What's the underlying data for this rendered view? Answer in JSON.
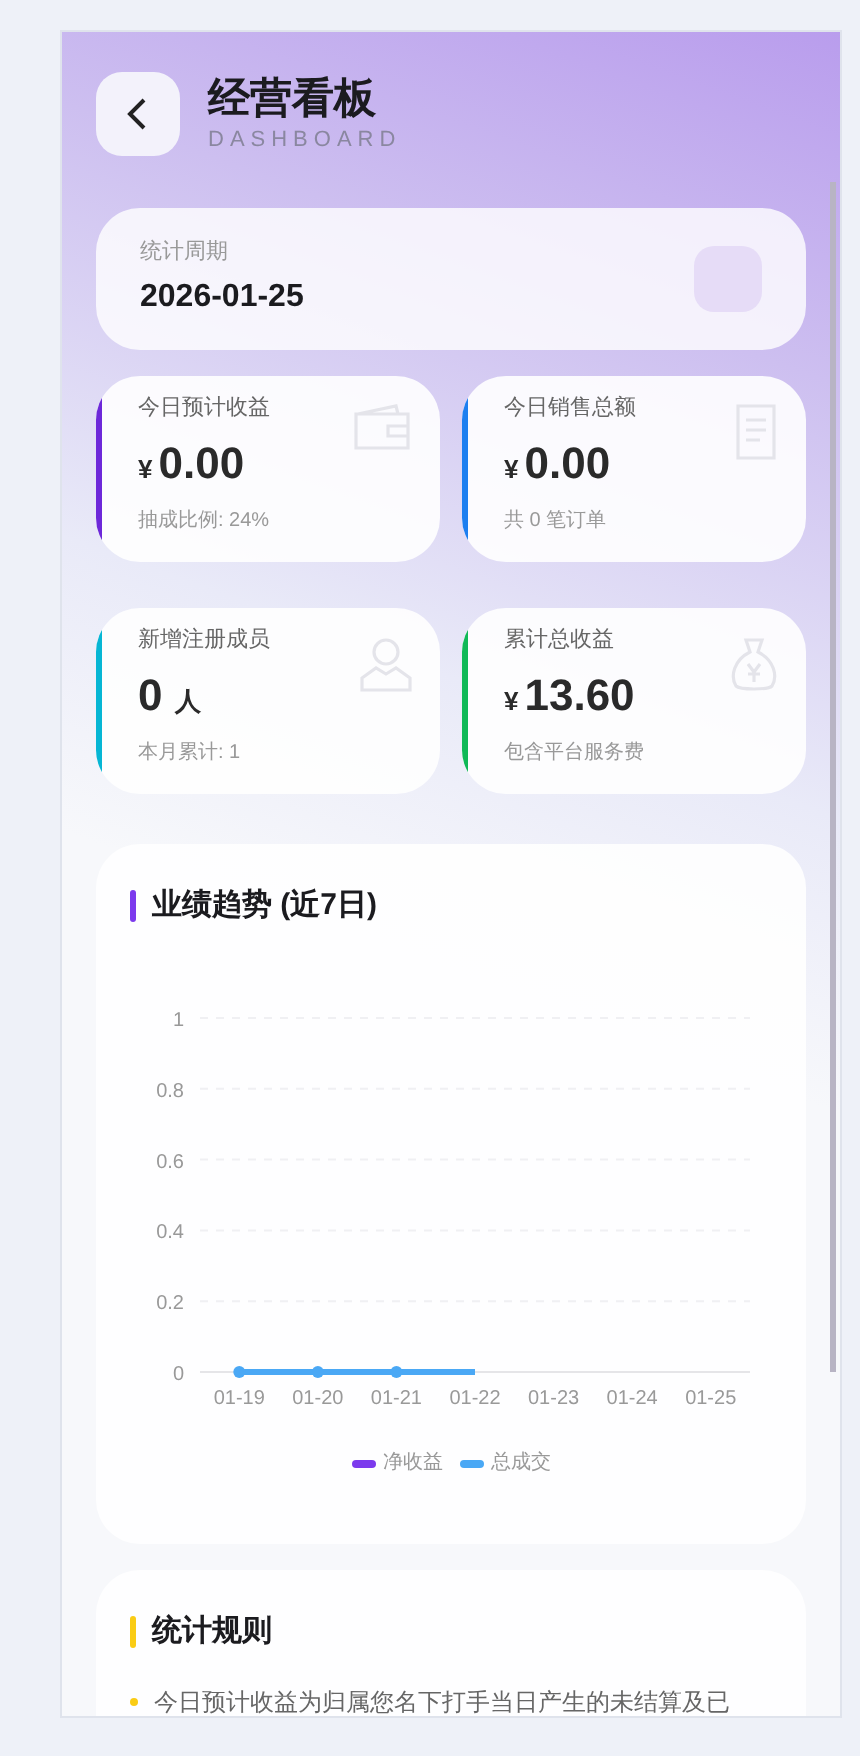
{
  "header": {
    "title": "经营看板",
    "subtitle": "DASHBOARD"
  },
  "period": {
    "label": "统计周期",
    "value": "2026-01-25"
  },
  "stats": [
    {
      "label": "今日预计收益",
      "currency": "¥",
      "value": "0.00",
      "note": "抽成比例: 24%",
      "color": "#6d28d9",
      "kind": "wallet"
    },
    {
      "label": "今日销售总额",
      "currency": "¥",
      "value": "0.00",
      "note": "共 0 笔订单",
      "color": "#1d7ff0",
      "kind": "document"
    },
    {
      "label": "新增注册成员",
      "value": "0",
      "unit": "人",
      "note": "本月累计: 1",
      "color": "#06b6d4",
      "kind": "person"
    },
    {
      "label": "累计总收益",
      "currency": "¥",
      "value": "13.60",
      "note": "包含平台服务费",
      "color": "#10b957",
      "kind": "moneybag"
    }
  ],
  "trend": {
    "title": "业绩趋势 (近7日)",
    "chart_data": {
      "type": "line",
      "categories": [
        "01-19",
        "01-20",
        "01-21",
        "01-22",
        "01-23",
        "01-24",
        "01-25"
      ],
      "series": [
        {
          "name": "净收益",
          "color": "#7c3aed",
          "values": [
            null,
            null,
            null,
            null,
            null,
            null,
            null
          ]
        },
        {
          "name": "总成交",
          "color": "#4aa8f5",
          "marker": "circle",
          "values": [
            0,
            0,
            0,
            0,
            null,
            null,
            null
          ]
        }
      ],
      "ylim": [
        0,
        1
      ],
      "yticks": [
        0,
        0.2,
        0.4,
        0.6,
        0.8,
        1
      ],
      "grid": true,
      "legend": "bottom"
    }
  },
  "rules": {
    "title": "统计规则",
    "items": [
      "今日预计收益为归属您名下打手当日产生的未结算及已"
    ]
  }
}
